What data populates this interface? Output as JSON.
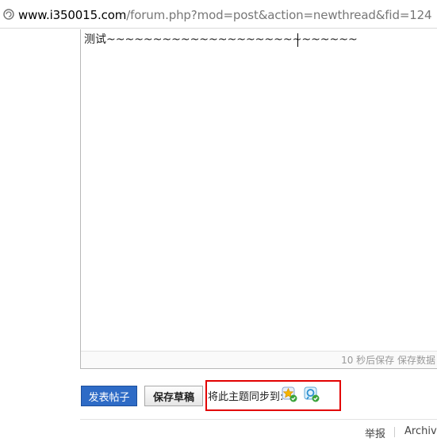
{
  "browser": {
    "url_domain": "www.i350015.com",
    "url_path": "/forum.php?mod=post&action=newthread&fid=124"
  },
  "editor": {
    "content": "测试~~~~~~~~~~~~~~~~~~~~~~~~~~~",
    "autosave_status": "10 秒后保存 保存数据"
  },
  "actions": {
    "submit_label": "发表帖子",
    "save_draft_label": "保存草稿",
    "sync_label": "将此主题同步到:",
    "sync_targets": [
      "qzone-icon",
      "tencent-weibo-icon"
    ]
  },
  "footer": {
    "report_label": "举报",
    "archive_label": "Archiver"
  },
  "colors": {
    "submit_button": "#2e6bc6",
    "highlight_box": "#e20000"
  }
}
